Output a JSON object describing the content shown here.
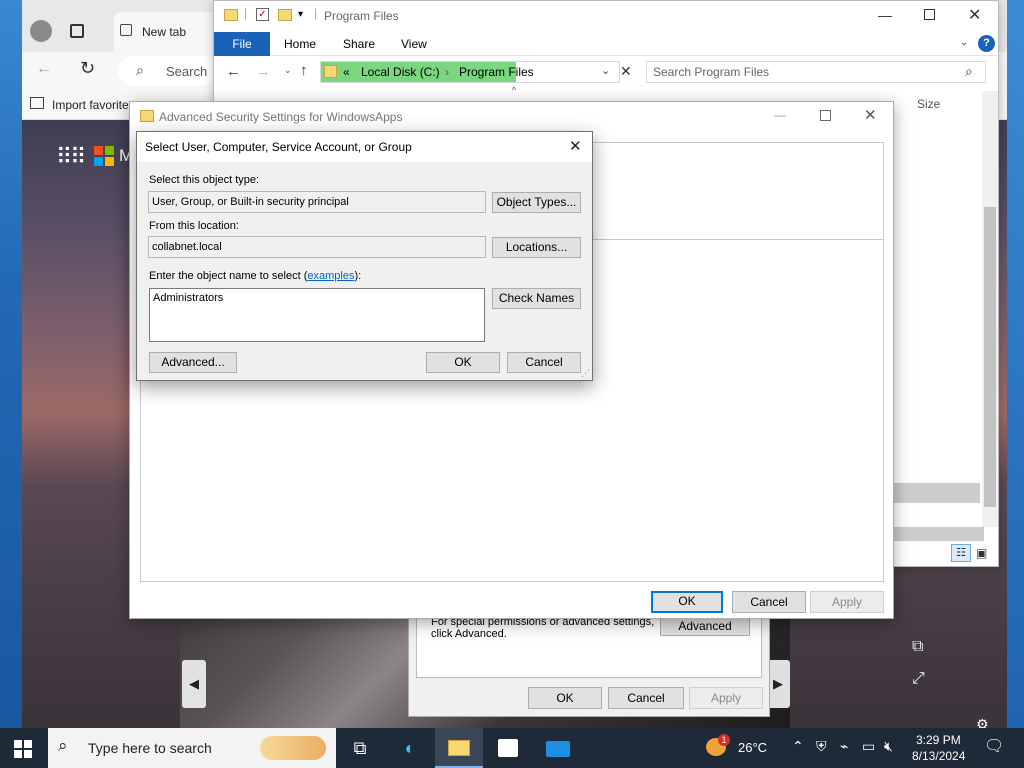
{
  "browser": {
    "tab_label": "New tab",
    "search_placeholder": "Search",
    "favorites_label": "Import favorite",
    "ms_fragment": "M"
  },
  "explorer": {
    "title": "Program Files",
    "ribbon_tabs": [
      "File",
      "Home",
      "Share",
      "View"
    ],
    "address": {
      "chevron": "«",
      "segment1": "Local Disk (C:)",
      "sep": "›",
      "segment2": "Program Files"
    },
    "search_placeholder": "Search Program Files",
    "column_size": "Size"
  },
  "advanced": {
    "title": "Advanced Security Settings for WindowsApps",
    "ok": "OK",
    "cancel": "Cancel",
    "apply": "Apply"
  },
  "permissions": {
    "text1": "For special permissions or advanced settings,",
    "text2": "click Advanced.",
    "advanced_btn": "Advanced",
    "ok": "OK",
    "cancel": "Cancel",
    "apply": "Apply"
  },
  "select_dialog": {
    "title": "Select User, Computer, Service Account, or Group",
    "object_type_label": "Select this object type:",
    "object_type_value": "User, Group, or Built-in security principal",
    "object_types_btn": "Object Types...",
    "location_label": "From this location:",
    "location_value": "collabnet.local",
    "locations_btn": "Locations...",
    "name_label_pre": "Enter the object name to select (",
    "name_label_link": "examples",
    "name_label_post": "):",
    "name_value": "Administrators",
    "check_names_btn": "Check Names",
    "advanced_btn": "Advanced...",
    "ok": "OK",
    "cancel": "Cancel"
  },
  "taskbar": {
    "search_placeholder": "Type here to search",
    "weather": "26°C",
    "time": "3:29 PM",
    "date": "8/13/2024",
    "mail_badge": "1"
  }
}
